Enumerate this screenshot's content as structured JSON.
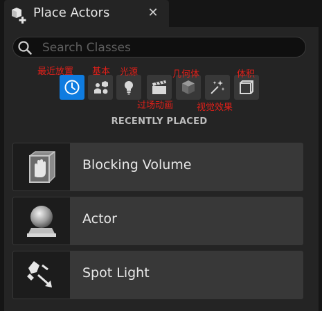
{
  "tab": {
    "title": "Place Actors",
    "close_glyph": "✕",
    "icon": "place-actors-icon"
  },
  "search": {
    "placeholder": "Search Classes",
    "value": "",
    "icon": "search-icon"
  },
  "categories": [
    {
      "label": "最近放置",
      "icon": "clock-icon",
      "active": true
    },
    {
      "label": "基本",
      "icon": "basic-shapes-icon",
      "active": false
    },
    {
      "label": "光源",
      "icon": "lightbulb-icon",
      "active": false
    },
    {
      "label": "过场动画",
      "icon": "clapperboard-icon",
      "active": false
    },
    {
      "label": "几何体",
      "icon": "cube-icon",
      "active": false
    },
    {
      "label": "视觉效果",
      "icon": "sparkles-icon",
      "active": false
    },
    {
      "label": "体积",
      "icon": "volume-box-icon",
      "active": false
    }
  ],
  "section_title": "RECENTLY PLACED",
  "items": [
    {
      "label": "Blocking Volume",
      "icon": "blocking-volume-icon"
    },
    {
      "label": "Actor",
      "icon": "actor-sphere-icon"
    },
    {
      "label": "Spot Light",
      "icon": "spot-light-icon"
    }
  ],
  "colors": {
    "accent": "#0f7ce0",
    "annotation": "#e0201a",
    "panel": "#242424",
    "item": "#383838"
  }
}
